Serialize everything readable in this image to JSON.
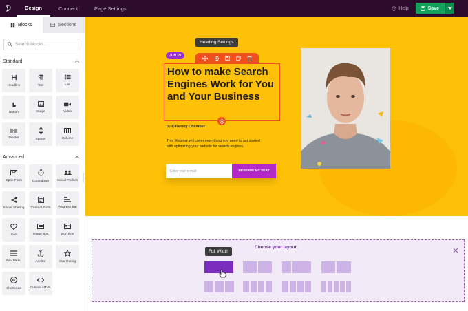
{
  "topbar": {
    "tabs": [
      "Design",
      "Connect",
      "Page Settings"
    ],
    "help": "Help",
    "save": "Save"
  },
  "sidebar": {
    "tabs": [
      "Blocks",
      "Sections"
    ],
    "search_placeholder": "Search blocks...",
    "standard": {
      "title": "Standard",
      "items": [
        {
          "label": "Headline",
          "icon": "headline-icon"
        },
        {
          "label": "Text",
          "icon": "text-icon"
        },
        {
          "label": "List",
          "icon": "list-icon"
        },
        {
          "label": "Button",
          "icon": "button-icon"
        },
        {
          "label": "Image",
          "icon": "image-icon"
        },
        {
          "label": "Video",
          "icon": "video-icon"
        },
        {
          "label": "Divider",
          "icon": "divider-icon"
        },
        {
          "label": "Spacer",
          "icon": "spacer-icon"
        },
        {
          "label": "Column",
          "icon": "column-icon"
        }
      ]
    },
    "advanced": {
      "title": "Advanced",
      "items": [
        {
          "label": "Optin Form",
          "icon": "optin-form-icon"
        },
        {
          "label": "Countdown",
          "icon": "countdown-icon"
        },
        {
          "label": "Social Profiles",
          "icon": "social-profiles-icon"
        },
        {
          "label": "Social Sharing",
          "icon": "share-icon"
        },
        {
          "label": "Contact Form",
          "icon": "contact-form-icon"
        },
        {
          "label": "Progress Bar",
          "icon": "progress-bar-icon"
        },
        {
          "label": "Icon",
          "icon": "heart-icon"
        },
        {
          "label": "Image Box",
          "icon": "image-box-icon"
        },
        {
          "label": "Icon Box",
          "icon": "icon-box-icon"
        },
        {
          "label": "Nav Menu",
          "icon": "menu-icon"
        },
        {
          "label": "Anchor",
          "icon": "anchor-icon"
        },
        {
          "label": "Star Rating",
          "icon": "star-icon"
        },
        {
          "label": "Shortcode",
          "icon": "wordpress-icon"
        },
        {
          "label": "Custom HTML",
          "icon": "code-icon"
        }
      ]
    }
  },
  "hero": {
    "tooltip": "Heading Settings",
    "date_badge": "JUN 19",
    "heading": "How to make Search Engines Work for You and Your Business",
    "byline_prefix": "by",
    "byline_author": "Killarney Chamber",
    "description": "This Webinar will cover everything you need to get started with optimizing your website for search engines.",
    "email_placeholder": "Enter your e-mail",
    "cta": "RESERVE MY SEAT"
  },
  "layout_chooser": {
    "title": "Choose your layout:",
    "tooltip": "Full Width",
    "selected": "Full Width"
  },
  "colors": {
    "topbar": "#2d0b2d",
    "hero_bg": "#ffc107",
    "accent_red": "#f04e1f",
    "purple": "#b229c7",
    "save_green": "#12a05a"
  }
}
